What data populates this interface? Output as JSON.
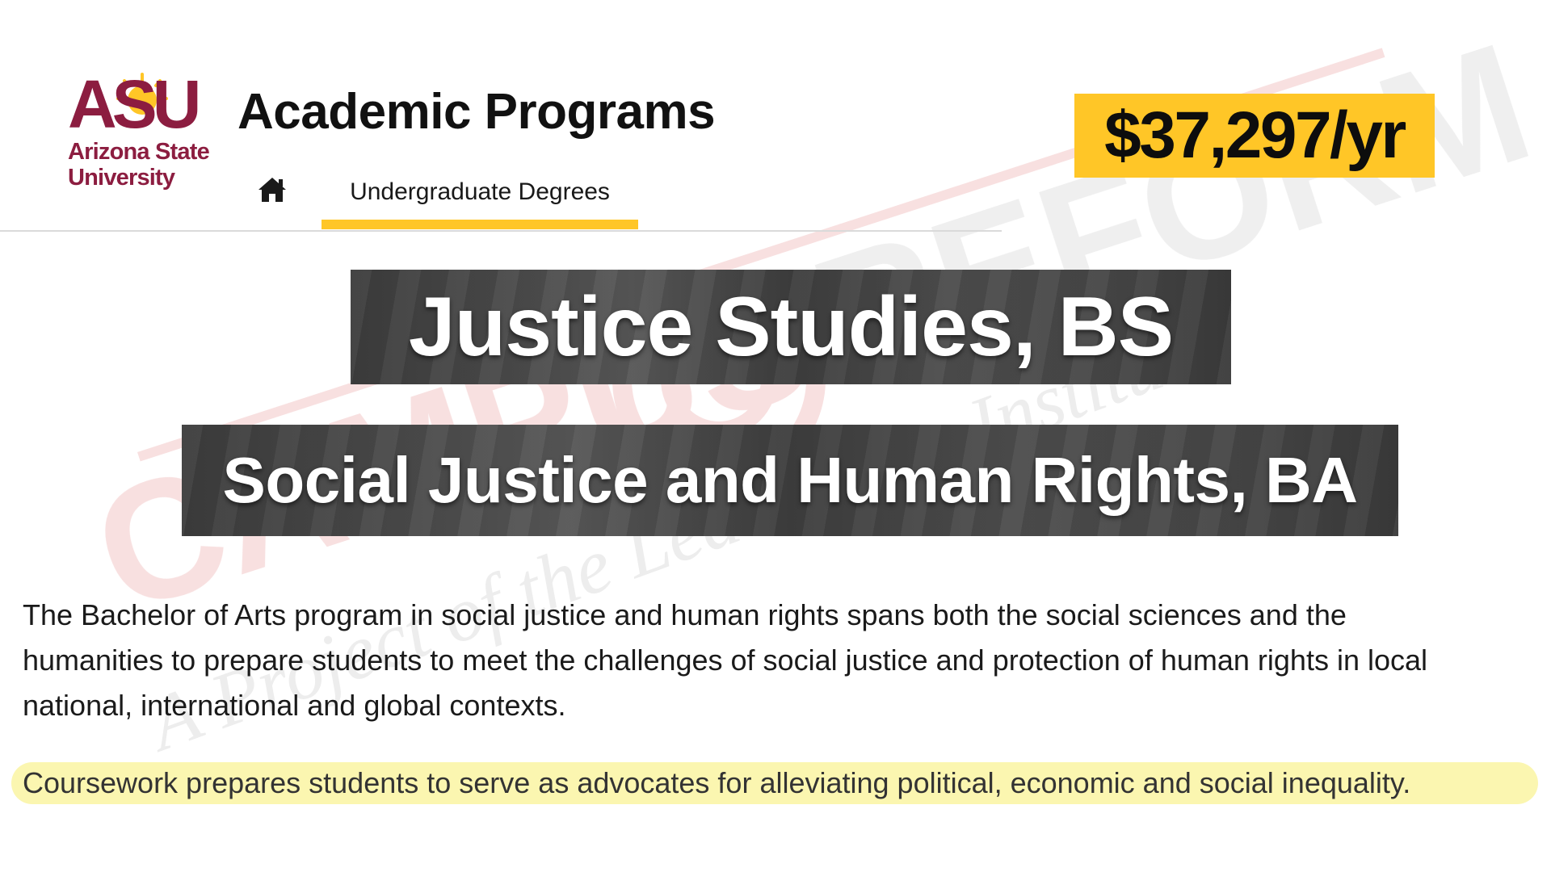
{
  "watermark": {
    "brand_part1": "CAMPUS",
    "brand_part2": "REFORM",
    "tagline": "A Project of the Leadership Institute",
    "color": "#e8a0a0"
  },
  "header": {
    "logo_mark": "ASU",
    "logo_name": "Arizona State\nUniversity",
    "title": "Academic Programs",
    "nav": {
      "home_icon": "home-icon",
      "tab_label": "Undergraduate Degrees"
    }
  },
  "price": "$37,297/yr",
  "programs": [
    "Justice Studies, BS",
    "Social Justice and Human Rights, BA"
  ],
  "description": {
    "lines": [
      "The Bachelor of Arts program in social justice and human rights spans both the social sciences and the",
      "humanities to prepare students to meet the challenges of social justice and protection of human rights in local",
      "national, international and global contexts."
    ],
    "highlight": "Coursework prepares students to serve as advocates for alleviating political, economic and social inequality."
  },
  "colors": {
    "asu_maroon": "#8c1d40",
    "asu_gold": "#ffc627",
    "highlight": "#fbf6b0",
    "banner_bg": "#474747"
  }
}
